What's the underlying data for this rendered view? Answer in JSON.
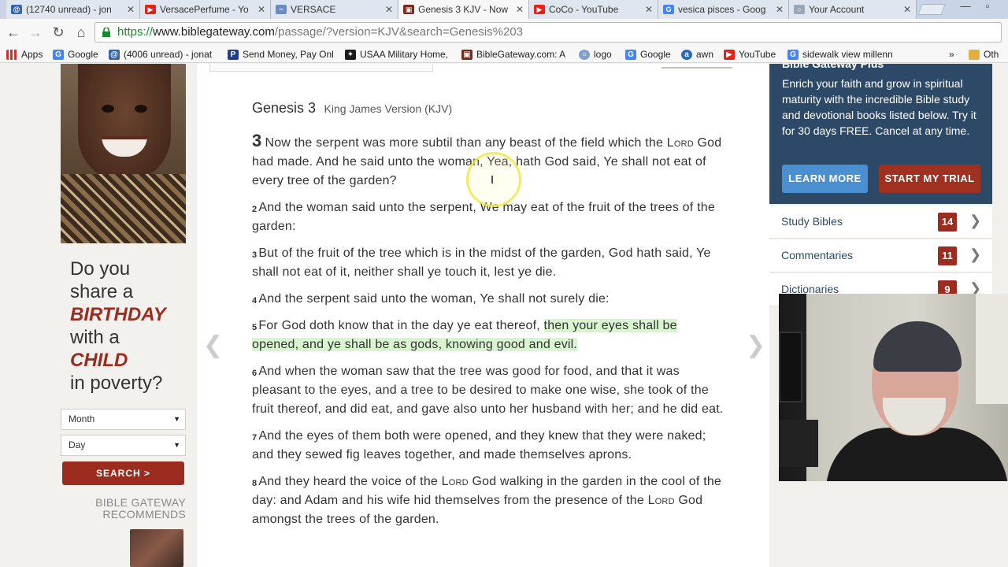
{
  "tabs": [
    {
      "title": "(12740 unread) - jon",
      "favicon": "mail-icon",
      "color": "#3366aa"
    },
    {
      "title": "VersacePerfume - Yo",
      "favicon": "youtube-icon",
      "color": "#e62117"
    },
    {
      "title": "VERSACE",
      "favicon": "page-icon",
      "color": "#6a8cc0"
    },
    {
      "title": "Genesis 3 KJV - Now",
      "favicon": "biblegateway-icon",
      "color": "#7a2a1a"
    },
    {
      "title": "CoCo - YouTube",
      "favicon": "youtube-icon",
      "color": "#e62117"
    },
    {
      "title": "vesica pisces - Goog",
      "favicon": "google-icon",
      "color": "#4285f4"
    },
    {
      "title": "Your Account",
      "favicon": "page-icon",
      "color": "#9aa7b9"
    }
  ],
  "toolbar": {
    "url_scheme": "https://",
    "url_host": "www.biblegateway.com",
    "url_rest": "/passage/?version=KJV&search=Genesis%203"
  },
  "bookmarks": [
    {
      "label": "Apps",
      "icon": "apps-grid-icon",
      "color": "#888888"
    },
    {
      "label": "Google",
      "icon": "google-icon",
      "color": "#4285f4"
    },
    {
      "label": "(4006 unread) - jonat",
      "icon": "mail-icon",
      "color": "#3366aa"
    },
    {
      "label": "Send Money, Pay Onl",
      "icon": "paypal-icon",
      "color": "#1f3f8a"
    },
    {
      "label": "USAA Military Home,",
      "icon": "usaa-icon",
      "color": "#1a1a1a"
    },
    {
      "label": "BibleGateway.com: A",
      "icon": "biblegateway-icon",
      "color": "#7a2a1a"
    },
    {
      "label": "logo",
      "icon": "logo-icon",
      "color": "#7f9fcf"
    },
    {
      "label": "Google",
      "icon": "google-icon",
      "color": "#4285f4"
    },
    {
      "label": "awn",
      "icon": "awn-icon",
      "color": "#2a6ab0"
    },
    {
      "label": "YouTube",
      "icon": "youtube-icon",
      "color": "#e62117"
    },
    {
      "label": "sidewalk view millenn",
      "icon": "google-icon",
      "color": "#4285f4"
    },
    {
      "label": "»",
      "icon": "more-icon",
      "color": "#555555"
    },
    {
      "label": "Oth",
      "icon": "folder-icon",
      "color": "#e0b040"
    }
  ],
  "ad": {
    "line1": "Do you",
    "line2": "share a",
    "em1": "BIRTHDAY",
    "line3": "with a",
    "em2": "CHILD",
    "line4": "in poverty?",
    "month": "Month",
    "day": "Day",
    "search": "SEARCH >",
    "recommends_1": "BIBLE GATEWAY",
    "recommends_2": "RECOMMENDS"
  },
  "passage": {
    "title": "Genesis 3",
    "version": "King James Version (KJV)",
    "verses": [
      {
        "num": "3",
        "chapter": true,
        "parts": [
          {
            "t": "Now the serpent was more subtil than any beast of the field which the "
          },
          {
            "t": "Lord",
            "sc": true
          },
          {
            "t": " God had made. And he said unto the woman, Yea, hath God said, Ye shall not eat of every tree of the garden?"
          }
        ]
      },
      {
        "num": "2",
        "parts": [
          {
            "t": "And the woman said unto the serpent, We may eat of the fruit of the trees of the garden:"
          }
        ]
      },
      {
        "num": "3",
        "parts": [
          {
            "t": "But of the fruit of the tree which is in the midst of the garden, God hath said, Ye shall not eat of it, neither shall ye touch it, lest ye die."
          }
        ]
      },
      {
        "num": "4",
        "parts": [
          {
            "t": "And the serpent said unto the woman, Ye shall not surely die:"
          }
        ]
      },
      {
        "num": "5",
        "parts": [
          {
            "t": "For God doth know that in the day ye eat thereof, "
          },
          {
            "t": "then your eyes shall be opened, and ye shall be as gods, knowing good and evil.",
            "hl": true
          }
        ]
      },
      {
        "num": "6",
        "parts": [
          {
            "t": "And when the woman saw that the tree was good for food, and that it was pleasant to the eyes, and a tree to be desired to make one wise, she took of the fruit thereof, and did eat, and gave also unto her husband with her; and he did eat."
          }
        ]
      },
      {
        "num": "7",
        "parts": [
          {
            "t": "And the eyes of them both were opened, and they knew that they were naked; and they sewed fig leaves together, and made themselves aprons."
          }
        ]
      },
      {
        "num": "8",
        "parts": [
          {
            "t": "And they heard the voice of the "
          },
          {
            "t": "Lord",
            "sc": true
          },
          {
            "t": " God walking in the garden in the cool of the day: and Adam and his wife hid themselves from the presence of the "
          },
          {
            "t": "Lord",
            "sc": true
          },
          {
            "t": " God amongst the trees of the garden."
          }
        ]
      }
    ]
  },
  "plus": {
    "heading": "Bible Gateway Plus",
    "body": "Enrich your faith and grow in spiritual maturity with the incredible Bible study and devotional books listed below. Try it for 30 days FREE. Cancel at any time.",
    "learn_more": "LEARN MORE",
    "start_trial": "START MY TRIAL"
  },
  "resources": [
    {
      "label": "Study Bibles",
      "count": "14"
    },
    {
      "label": "Commentaries",
      "count": "11"
    },
    {
      "label": "Dictionaries",
      "count": "9"
    }
  ],
  "colors": {
    "brand_red": "#9b2c1f",
    "plus_blue": "#2c4a68",
    "learn_blue": "#4a8fd0",
    "highlight_green": "#d8f5cf"
  }
}
